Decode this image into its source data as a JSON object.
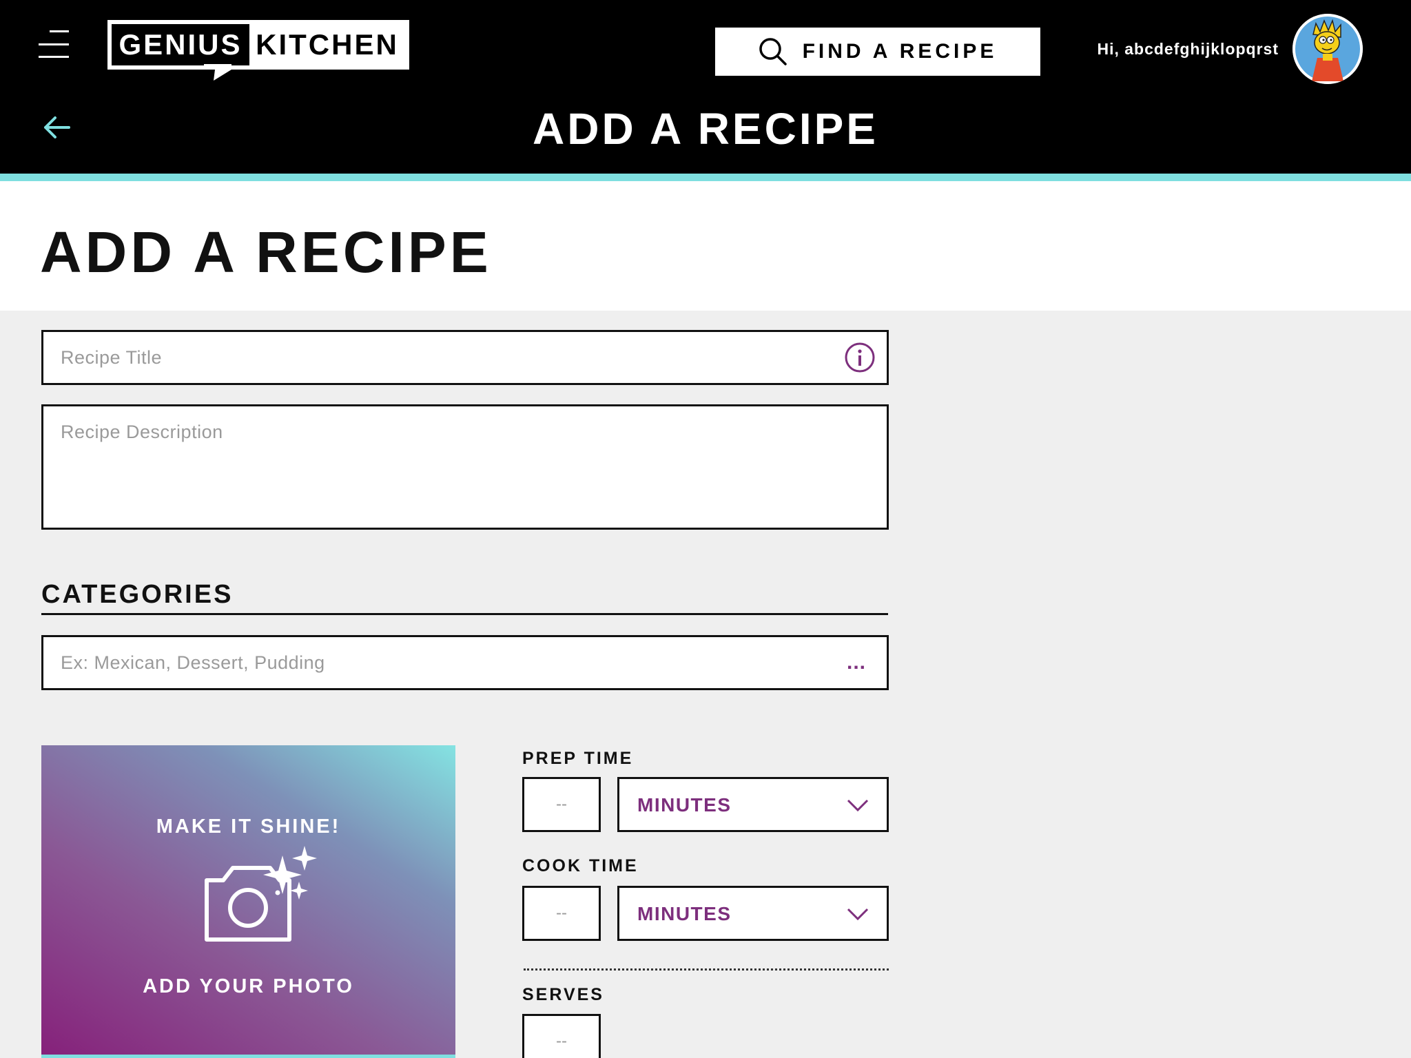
{
  "header": {
    "logo": {
      "left_text": "GENIUS",
      "right_text": "KITCHEN"
    },
    "search": {
      "label": "FIND A RECIPE"
    },
    "greeting": "Hi, abcdefghijklopqrst",
    "nav_title": "ADD A RECIPE"
  },
  "page": {
    "title": "ADD A RECIPE"
  },
  "form": {
    "recipe_title": {
      "placeholder": "Recipe Title"
    },
    "recipe_description": {
      "placeholder": "Recipe Description"
    },
    "categories": {
      "label": "CATEGORIES",
      "placeholder": "Ex: Mexican, Dessert, Pudding",
      "more": "..."
    },
    "photo": {
      "headline": "MAKE IT SHINE!",
      "action": "ADD YOUR PHOTO"
    },
    "prep_time": {
      "label": "PREP TIME",
      "value": "--",
      "unit": "MINUTES"
    },
    "cook_time": {
      "label": "COOK TIME",
      "value": "--",
      "unit": "MINUTES"
    },
    "serves": {
      "label": "SERVES",
      "value": "--"
    }
  },
  "colors": {
    "accent": "#7fdfe0",
    "brand_purple": "#7d2f7d",
    "header_bg": "#000000",
    "page_bg": "#efefef"
  },
  "icons": [
    "hamburger-menu-icon",
    "search-icon",
    "back-arrow-icon",
    "info-icon",
    "chevron-down-icon",
    "camera-icon",
    "sparkle-icon"
  ]
}
